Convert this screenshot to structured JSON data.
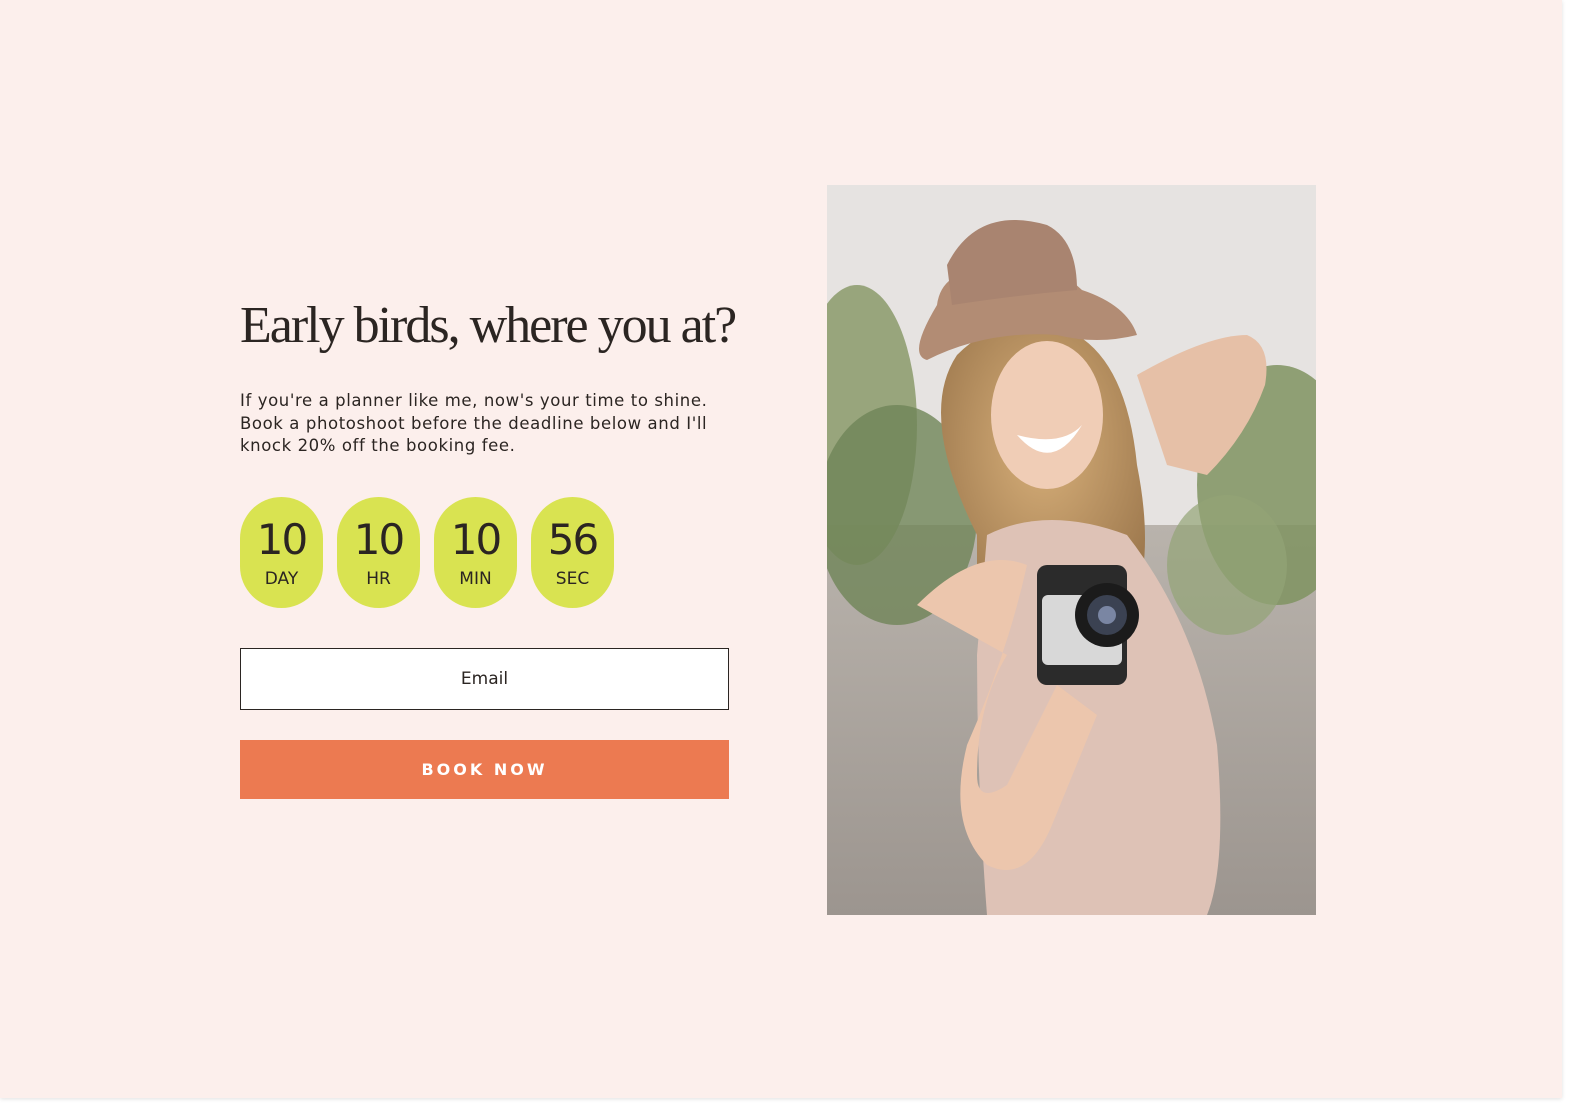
{
  "hero": {
    "headline": "Early birds, where you at?",
    "description": "If you're a planner like me, now's your time to shine. Book a photoshoot before the deadline below and I'll knock 20% off the booking fee."
  },
  "countdown": [
    {
      "value": "10",
      "label": "DAY"
    },
    {
      "value": "10",
      "label": "HR"
    },
    {
      "value": "10",
      "label": "MIN"
    },
    {
      "value": "56",
      "label": "SEC"
    }
  ],
  "form": {
    "email_placeholder": "Email",
    "submit_label": "BOOK NOW"
  },
  "photo": {
    "icon": "photo-of-woman-with-hat-and-camera"
  },
  "colors": {
    "background": "#fcefec",
    "timer_pill": "#d9e351",
    "button": "#ec7a51",
    "text": "#2b2522"
  }
}
